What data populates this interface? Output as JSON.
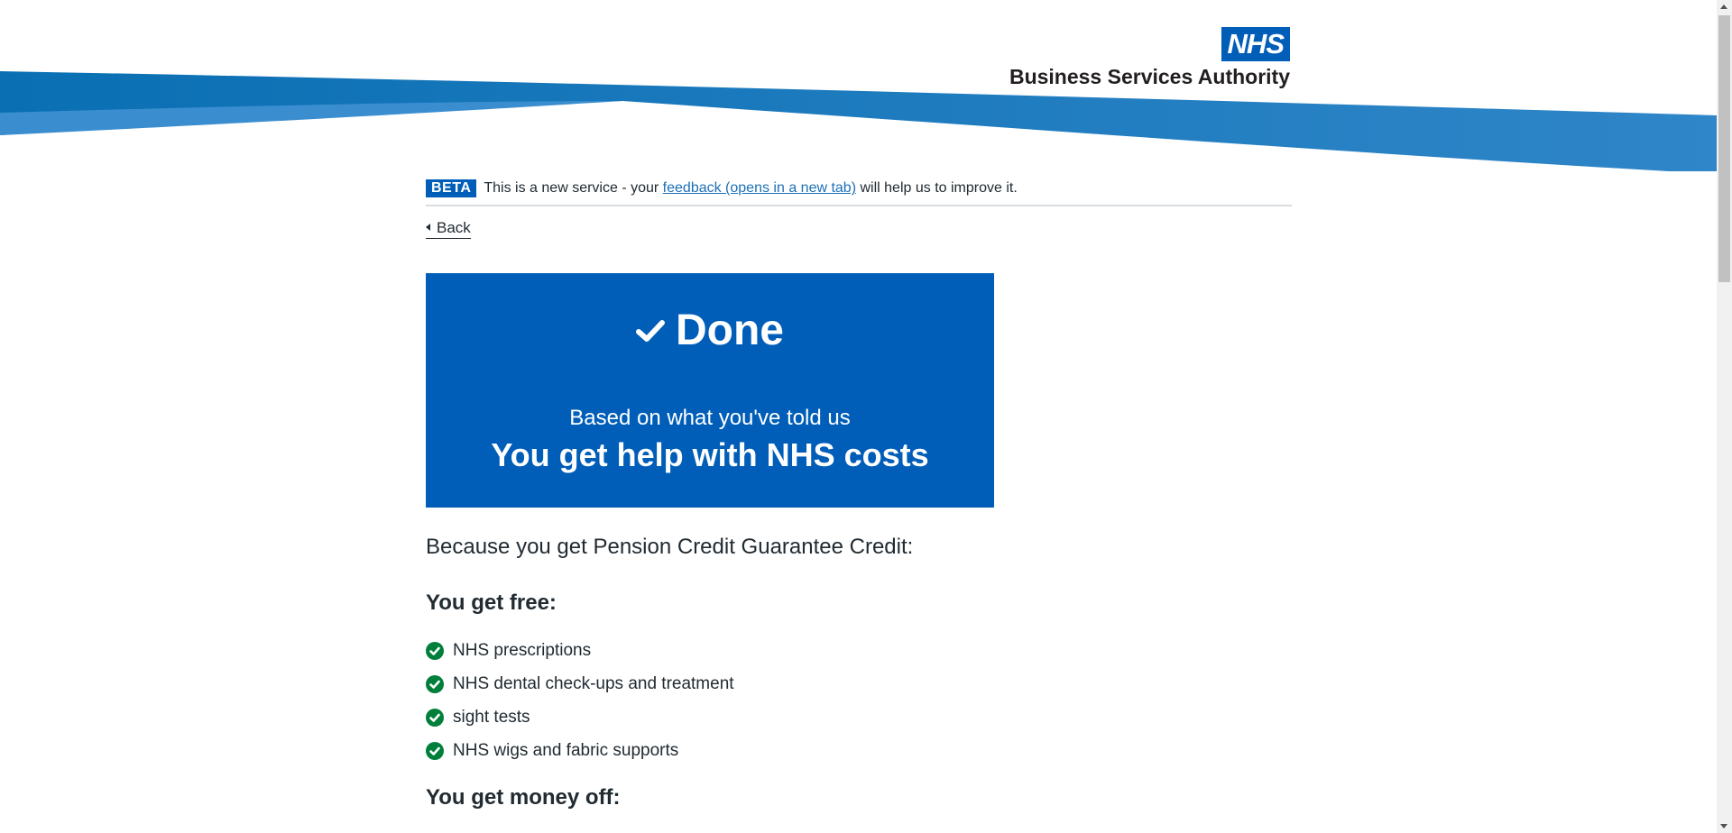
{
  "header": {
    "logo_text": "NHS",
    "brand_name": "Business Services Authority"
  },
  "phase_banner": {
    "tag": "BETA",
    "text_before": "This is a new service - your",
    "link_text": "feedback (opens in a new tab)",
    "text_after": "will help us to improve it."
  },
  "back_link": "Back",
  "panel": {
    "title": "Done",
    "subtitle": "Based on what you've told us",
    "result": "You get help with NHS costs"
  },
  "intro": "Because you get Pension Credit Guarantee Credit:",
  "free_section": {
    "heading": "You get free:",
    "items": [
      "NHS prescriptions",
      "NHS dental check-ups and treatment",
      "sight tests",
      "NHS wigs and fabric supports"
    ]
  },
  "money_off_section": {
    "heading": "You get money off:"
  },
  "colors": {
    "nhs_blue": "#005eb8",
    "success_green": "#007f3b",
    "link_blue": "#1d70b8",
    "text": "#212b32"
  }
}
